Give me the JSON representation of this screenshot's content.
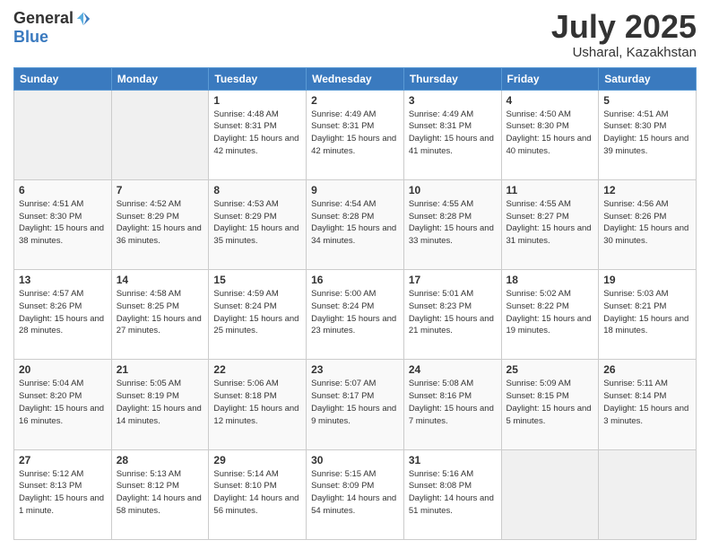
{
  "logo": {
    "general": "General",
    "blue": "Blue"
  },
  "title": {
    "month": "July 2025",
    "location": "Usharal, Kazakhstan"
  },
  "weekdays": [
    "Sunday",
    "Monday",
    "Tuesday",
    "Wednesday",
    "Thursday",
    "Friday",
    "Saturday"
  ],
  "weeks": [
    [
      {
        "day": "",
        "sunrise": "",
        "sunset": "",
        "daylight": ""
      },
      {
        "day": "",
        "sunrise": "",
        "sunset": "",
        "daylight": ""
      },
      {
        "day": "1",
        "sunrise": "Sunrise: 4:48 AM",
        "sunset": "Sunset: 8:31 PM",
        "daylight": "Daylight: 15 hours and 42 minutes."
      },
      {
        "day": "2",
        "sunrise": "Sunrise: 4:49 AM",
        "sunset": "Sunset: 8:31 PM",
        "daylight": "Daylight: 15 hours and 42 minutes."
      },
      {
        "day": "3",
        "sunrise": "Sunrise: 4:49 AM",
        "sunset": "Sunset: 8:31 PM",
        "daylight": "Daylight: 15 hours and 41 minutes."
      },
      {
        "day": "4",
        "sunrise": "Sunrise: 4:50 AM",
        "sunset": "Sunset: 8:30 PM",
        "daylight": "Daylight: 15 hours and 40 minutes."
      },
      {
        "day": "5",
        "sunrise": "Sunrise: 4:51 AM",
        "sunset": "Sunset: 8:30 PM",
        "daylight": "Daylight: 15 hours and 39 minutes."
      }
    ],
    [
      {
        "day": "6",
        "sunrise": "Sunrise: 4:51 AM",
        "sunset": "Sunset: 8:30 PM",
        "daylight": "Daylight: 15 hours and 38 minutes."
      },
      {
        "day": "7",
        "sunrise": "Sunrise: 4:52 AM",
        "sunset": "Sunset: 8:29 PM",
        "daylight": "Daylight: 15 hours and 36 minutes."
      },
      {
        "day": "8",
        "sunrise": "Sunrise: 4:53 AM",
        "sunset": "Sunset: 8:29 PM",
        "daylight": "Daylight: 15 hours and 35 minutes."
      },
      {
        "day": "9",
        "sunrise": "Sunrise: 4:54 AM",
        "sunset": "Sunset: 8:28 PM",
        "daylight": "Daylight: 15 hours and 34 minutes."
      },
      {
        "day": "10",
        "sunrise": "Sunrise: 4:55 AM",
        "sunset": "Sunset: 8:28 PM",
        "daylight": "Daylight: 15 hours and 33 minutes."
      },
      {
        "day": "11",
        "sunrise": "Sunrise: 4:55 AM",
        "sunset": "Sunset: 8:27 PM",
        "daylight": "Daylight: 15 hours and 31 minutes."
      },
      {
        "day": "12",
        "sunrise": "Sunrise: 4:56 AM",
        "sunset": "Sunset: 8:26 PM",
        "daylight": "Daylight: 15 hours and 30 minutes."
      }
    ],
    [
      {
        "day": "13",
        "sunrise": "Sunrise: 4:57 AM",
        "sunset": "Sunset: 8:26 PM",
        "daylight": "Daylight: 15 hours and 28 minutes."
      },
      {
        "day": "14",
        "sunrise": "Sunrise: 4:58 AM",
        "sunset": "Sunset: 8:25 PM",
        "daylight": "Daylight: 15 hours and 27 minutes."
      },
      {
        "day": "15",
        "sunrise": "Sunrise: 4:59 AM",
        "sunset": "Sunset: 8:24 PM",
        "daylight": "Daylight: 15 hours and 25 minutes."
      },
      {
        "day": "16",
        "sunrise": "Sunrise: 5:00 AM",
        "sunset": "Sunset: 8:24 PM",
        "daylight": "Daylight: 15 hours and 23 minutes."
      },
      {
        "day": "17",
        "sunrise": "Sunrise: 5:01 AM",
        "sunset": "Sunset: 8:23 PM",
        "daylight": "Daylight: 15 hours and 21 minutes."
      },
      {
        "day": "18",
        "sunrise": "Sunrise: 5:02 AM",
        "sunset": "Sunset: 8:22 PM",
        "daylight": "Daylight: 15 hours and 19 minutes."
      },
      {
        "day": "19",
        "sunrise": "Sunrise: 5:03 AM",
        "sunset": "Sunset: 8:21 PM",
        "daylight": "Daylight: 15 hours and 18 minutes."
      }
    ],
    [
      {
        "day": "20",
        "sunrise": "Sunrise: 5:04 AM",
        "sunset": "Sunset: 8:20 PM",
        "daylight": "Daylight: 15 hours and 16 minutes."
      },
      {
        "day": "21",
        "sunrise": "Sunrise: 5:05 AM",
        "sunset": "Sunset: 8:19 PM",
        "daylight": "Daylight: 15 hours and 14 minutes."
      },
      {
        "day": "22",
        "sunrise": "Sunrise: 5:06 AM",
        "sunset": "Sunset: 8:18 PM",
        "daylight": "Daylight: 15 hours and 12 minutes."
      },
      {
        "day": "23",
        "sunrise": "Sunrise: 5:07 AM",
        "sunset": "Sunset: 8:17 PM",
        "daylight": "Daylight: 15 hours and 9 minutes."
      },
      {
        "day": "24",
        "sunrise": "Sunrise: 5:08 AM",
        "sunset": "Sunset: 8:16 PM",
        "daylight": "Daylight: 15 hours and 7 minutes."
      },
      {
        "day": "25",
        "sunrise": "Sunrise: 5:09 AM",
        "sunset": "Sunset: 8:15 PM",
        "daylight": "Daylight: 15 hours and 5 minutes."
      },
      {
        "day": "26",
        "sunrise": "Sunrise: 5:11 AM",
        "sunset": "Sunset: 8:14 PM",
        "daylight": "Daylight: 15 hours and 3 minutes."
      }
    ],
    [
      {
        "day": "27",
        "sunrise": "Sunrise: 5:12 AM",
        "sunset": "Sunset: 8:13 PM",
        "daylight": "Daylight: 15 hours and 1 minute."
      },
      {
        "day": "28",
        "sunrise": "Sunrise: 5:13 AM",
        "sunset": "Sunset: 8:12 PM",
        "daylight": "Daylight: 14 hours and 58 minutes."
      },
      {
        "day": "29",
        "sunrise": "Sunrise: 5:14 AM",
        "sunset": "Sunset: 8:10 PM",
        "daylight": "Daylight: 14 hours and 56 minutes."
      },
      {
        "day": "30",
        "sunrise": "Sunrise: 5:15 AM",
        "sunset": "Sunset: 8:09 PM",
        "daylight": "Daylight: 14 hours and 54 minutes."
      },
      {
        "day": "31",
        "sunrise": "Sunrise: 5:16 AM",
        "sunset": "Sunset: 8:08 PM",
        "daylight": "Daylight: 14 hours and 51 minutes."
      },
      {
        "day": "",
        "sunrise": "",
        "sunset": "",
        "daylight": ""
      },
      {
        "day": "",
        "sunrise": "",
        "sunset": "",
        "daylight": ""
      }
    ]
  ]
}
